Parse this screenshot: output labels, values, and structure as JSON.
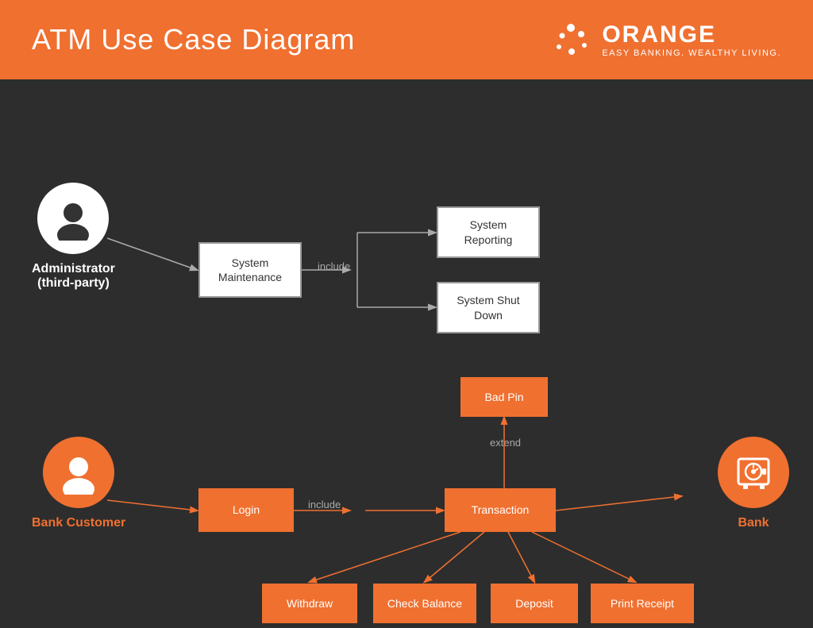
{
  "header": {
    "title": "ATM Use Case Diagram",
    "logo_name": "ORANGE",
    "logo_tagline": "EASY BANKING. WEALTHY LIVING."
  },
  "actors": {
    "administrator": {
      "label": "Administrator\n(third-party)"
    },
    "bank_customer": {
      "label": "Bank Customer"
    },
    "bank": {
      "label": "Bank"
    }
  },
  "boxes": {
    "system_maintenance": "System\nMaintenance",
    "system_reporting": "System\nReporting",
    "system_shut_down": "System\nShut Down",
    "bad_pin": "Bad Pin",
    "login": "Login",
    "transaction": "Transaction",
    "withdraw": "Withdraw",
    "check_balance": "Check Balance",
    "deposit": "Deposit",
    "print_receipt": "Print Receipt"
  },
  "labels": {
    "include1": "include",
    "include2": "include",
    "extend": "extend"
  },
  "colors": {
    "orange": "#f07030",
    "white": "#ffffff",
    "dark_bg": "#2d2d2d",
    "arrow_color": "#f07030",
    "white_arrow": "#999999"
  }
}
